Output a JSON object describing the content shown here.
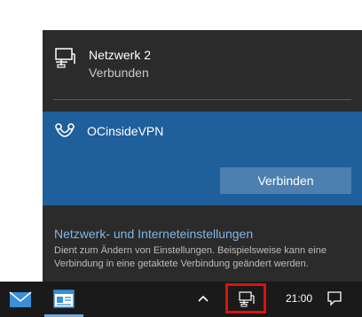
{
  "flyout": {
    "network": {
      "name": "Netzwerk 2",
      "status": "Verbunden",
      "icon": "ethernet-network-icon"
    },
    "vpn": {
      "name": "OCinsideVPN",
      "icon": "vpn-icon",
      "connect_label": "Verbinden",
      "selected": true
    },
    "settings": {
      "link_label": "Netzwerk- und Interneteinstellungen",
      "description": "Dient zum Ändern von Einstellungen. Beispielsweise kann eine Verbindung in eine getaktete Verbindung geändert werden."
    }
  },
  "taskbar": {
    "apps": [
      {
        "icon": "mail-icon"
      },
      {
        "icon": "app-window-icon",
        "active": true
      }
    ],
    "tray": {
      "chevron_icon": "chevron-up-icon",
      "network_icon": "ethernet-network-icon",
      "network_highlighted": true,
      "clock": "21:00",
      "notification_icon": "action-center-icon"
    }
  },
  "colors": {
    "flyout_bg": "#2b2b2b",
    "vpn_selected_bg": "#1f5f9c",
    "button_bg": "#4d7fb0",
    "link": "#7fb6ea",
    "taskbar_bg": "#1a1a1a",
    "highlight_box": "#e01010"
  }
}
